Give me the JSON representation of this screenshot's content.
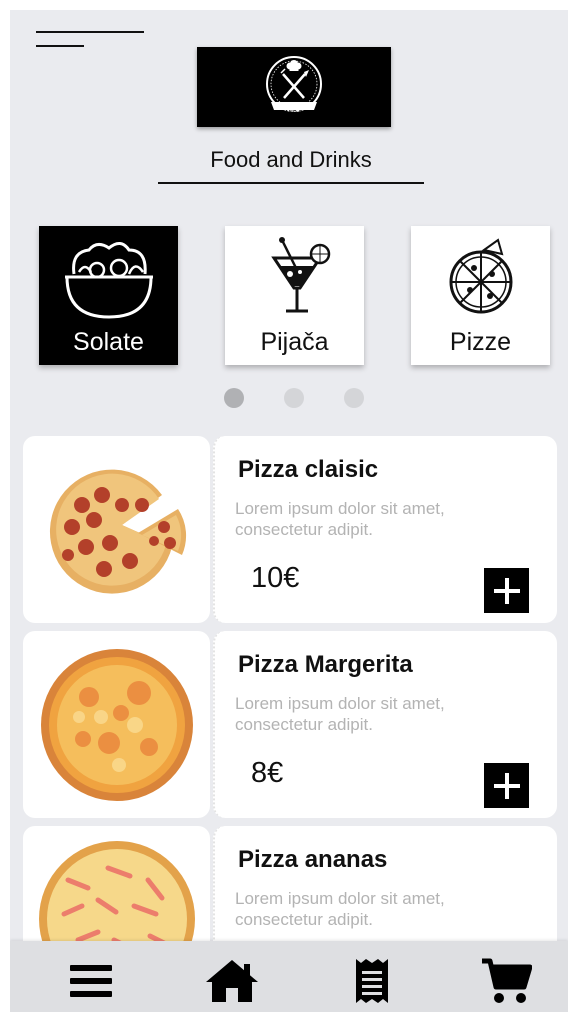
{
  "brand": {
    "logo_text": "FOOD AND DRINKS",
    "title": "Food and Drinks"
  },
  "categories": [
    {
      "label": "Solate",
      "icon": "salad-bowl-icon",
      "active": true
    },
    {
      "label": "Pijača",
      "icon": "cocktail-icon",
      "active": false
    },
    {
      "label": "Pizze",
      "icon": "pizza-icon",
      "active": false
    }
  ],
  "carousel": {
    "pages": 3,
    "current": 1
  },
  "products": [
    {
      "name": "Pizza claisic",
      "description": "Lorem ipsum dolor sit amet, consectetur adipit.",
      "price": "10€",
      "image": "pepperoni-pizza-image"
    },
    {
      "name": "Pizza Margerita",
      "description": "Lorem ipsum dolor sit amet, consectetur adipit.",
      "price": "8€",
      "image": "margherita-pizza-image"
    },
    {
      "name": "Pizza ananas",
      "description": "Lorem ipsum dolor sit amet, consectetur adipit.",
      "price": "",
      "image": "ham-pizza-image"
    }
  ],
  "bottom_nav": [
    {
      "icon": "menu-icon"
    },
    {
      "icon": "home-icon"
    },
    {
      "icon": "receipt-icon"
    },
    {
      "icon": "cart-icon"
    }
  ],
  "colors": {
    "background": "#eaebef",
    "accent": "#000000",
    "muted_text": "#b3b3b3"
  }
}
